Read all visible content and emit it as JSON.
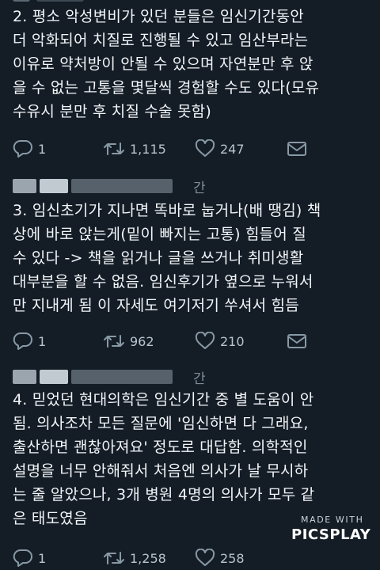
{
  "tweets": [
    {
      "text": "2. 평소 악성변비가 있던 분들은 임신기간동안\n더 악화되어 치질로 진행될 수 있고 임산부라는\n이유로 약처방이 안될 수 있으며 자연분만 후 앉\n을 수 없는 고통을 몇달씩 경험할 수도 있다(모유\n수유시 분만 후 치질 수술 못함)",
      "reply_count": "1",
      "retweet_count": "1,115",
      "like_count": "247"
    },
    {
      "meta_suffix": "간",
      "text": "3. 임신초기가 지나면 똑바로 눕거나(배 땡김) 책\n상에 바로 앉는게(밑이 빠지는 고통) 힘들어 질\n수 있다 -> 책을 읽거나 글을 쓰거나 취미생활\n대부분을 할 수 없음. 임신후기가 옆으로 누워서\n만 지내게 됨 이 자세도 여기저기 쑤셔서 힘듬",
      "reply_count": "1",
      "retweet_count": "962",
      "like_count": "210"
    },
    {
      "meta_suffix": "간",
      "text": "4. 믿었던 현대의학은 임신기간 중 별 도움이 안\n됨. 의사조차 모든 질문에 '임신하면 다 그래요,\n출산하면 괜찮아져요' 정도로 대답함. 의학적인\n설명을 너무 안해줘서 처음엔 의사가 날 무시하\n는 줄 알았으나, 3개 병원 4명의 의사가 모두 같\n은 태도였음",
      "reply_count": "1",
      "retweet_count": "1,258",
      "like_count": "258"
    }
  ],
  "icons": {
    "reply": "reply-icon",
    "retweet": "retweet-icon",
    "like": "heart-icon",
    "message": "message-icon"
  },
  "watermark": {
    "made_with": "MADE WITH",
    "brand": "PICSPLAY"
  },
  "colors": {
    "background": "#141d26",
    "text": "#f2f5f8",
    "icon": "#8899a6"
  }
}
